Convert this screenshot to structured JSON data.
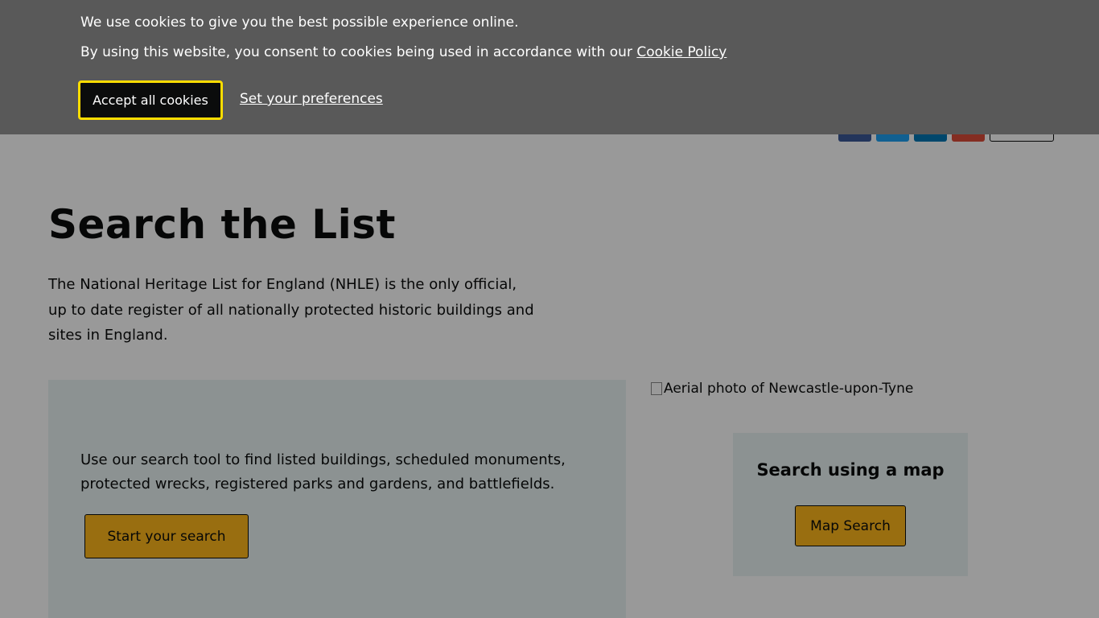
{
  "cookie": {
    "line1": "We use cookies to give you the best possible experience online.",
    "line2_prefix": "By using this website, you consent to cookies being used in accordance with our ",
    "policy_link": "Cookie Policy",
    "accept_label": "Accept all cookies",
    "preferences_label": "Set your preferences"
  },
  "nav": {
    "links": [
      "",
      ""
    ]
  },
  "social": {
    "icons": [
      "facebook-icon",
      "twitter-icon",
      "linkedin-icon",
      "email-icon"
    ],
    "colors": [
      "#3b5998",
      "#1da1f2",
      "#0077b5",
      "#dd4b39"
    ]
  },
  "main": {
    "title": "Search the List",
    "intro": "The National Heritage List for England (NHLE) is the only official, up to date register of all nationally protected historic buildings and sites in England.",
    "search_text": "Use our search tool to find listed buildings, scheduled monuments, protected wrecks, registered parks and gardens, and battlefields.",
    "search_button": "Start your search",
    "aerial_alt": "Aerial photo of Newcastle-upon-Tyne",
    "map_heading": "Search using a map",
    "map_button": "Map Search"
  },
  "colors": {
    "banner_bg": "#595959",
    "accent_gold": "#ffb81c",
    "panel_bg": "#e9f3f3",
    "focus_yellow": "#ffdd00"
  }
}
